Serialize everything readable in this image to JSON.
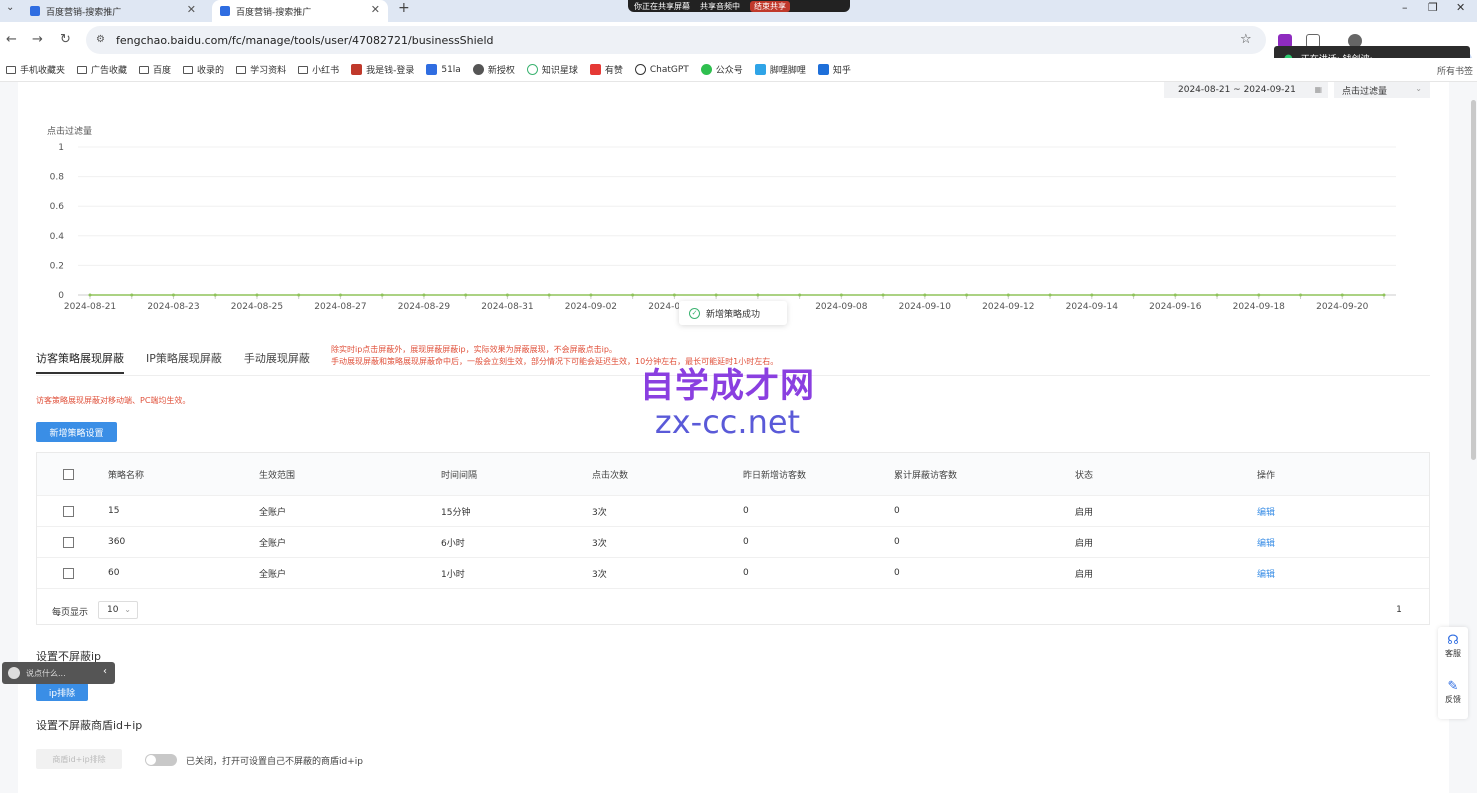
{
  "browser": {
    "tabs": [
      {
        "title": "百度营销-搜索推广"
      },
      {
        "title": "百度营销-搜索推广"
      }
    ],
    "share_bar": {
      "status": "你正在共享屏幕",
      "audio": "共享音频中",
      "end": "结束共享"
    },
    "url": "fengchao.baidu.com/fc/manage/tools/user/47082721/businessShield",
    "speaking_popup": "正在讲话: 钱剑波;",
    "bookmarks": [
      "手机收藏夹",
      "广告收藏",
      "百度",
      "收录的",
      "学习资料",
      "小红书",
      "我是钱-登录",
      "51la",
      "新授权",
      "知识星球",
      "有赞",
      "ChatGPT",
      "公众号",
      "脚哩脚哩",
      "知乎"
    ],
    "bookmarks_right": "所有书签"
  },
  "filters": {
    "date_range": "2024-08-21 ~ 2024-09-21",
    "metric": "点击过滤量"
  },
  "chart_data": {
    "type": "line",
    "ylabel": "点击过滤量",
    "ylim": [
      0,
      1
    ],
    "yticks": [
      "1",
      "0.8",
      "0.6",
      "0.4",
      "0.2",
      "0"
    ],
    "xticks": [
      "2024-08-21",
      "2024-08-23",
      "2024-08-25",
      "2024-08-27",
      "2024-08-29",
      "2024-08-31",
      "2024-09-02",
      "2024-09-04",
      "2024-09-06",
      "2024-09-08",
      "2024-09-10",
      "2024-09-12",
      "2024-09-14",
      "2024-09-16",
      "2024-09-18",
      "2024-09-20"
    ],
    "x": [
      "2024-08-21",
      "2024-08-22",
      "2024-08-23",
      "2024-08-24",
      "2024-08-25",
      "2024-08-26",
      "2024-08-27",
      "2024-08-28",
      "2024-08-29",
      "2024-08-30",
      "2024-08-31",
      "2024-09-01",
      "2024-09-02",
      "2024-09-03",
      "2024-09-04",
      "2024-09-05",
      "2024-09-06",
      "2024-09-07",
      "2024-09-08",
      "2024-09-09",
      "2024-09-10",
      "2024-09-11",
      "2024-09-12",
      "2024-09-13",
      "2024-09-14",
      "2024-09-15",
      "2024-09-16",
      "2024-09-17",
      "2024-09-18",
      "2024-09-19",
      "2024-09-20",
      "2024-09-21"
    ],
    "series": [
      {
        "values": [
          0,
          0,
          0,
          0,
          0,
          0,
          0,
          0,
          0,
          0,
          0,
          0,
          0,
          0,
          0,
          0,
          0,
          0,
          0,
          0,
          0,
          0,
          0,
          0,
          0,
          0,
          0,
          0,
          0,
          0,
          0,
          0
        ],
        "color": "#8fc35a"
      }
    ],
    "grid": true
  },
  "toast": "新增策略成功",
  "tabs": [
    "访客策略展现屏蔽",
    "IP策略展现屏蔽",
    "手动展现屏蔽"
  ],
  "tab_note": [
    "除实时ip点击屏蔽外，展现屏蔽屏蔽ip，实际效果为屏蔽展现，不会屏蔽点击ip。",
    "手动展现屏蔽和策略展现屏蔽命中后，一般会立刻生效，部分情况下可能会延迟生效，10分钟左右，最长可能延时1小时左右。"
  ],
  "mobile_note": "访客策略展现屏蔽对移动端、PC端均生效。",
  "add_button": "新增策略设置",
  "table": {
    "headers": [
      "策略名称",
      "生效范围",
      "时间间隔",
      "点击次数",
      "昨日新增访客数",
      "累计屏蔽访客数",
      "状态",
      "操作"
    ],
    "rows": [
      [
        "15",
        "全账户",
        "15分钟",
        "3次",
        "0",
        "0",
        "启用",
        "编辑"
      ],
      [
        "360",
        "全账户",
        "6小时",
        "3次",
        "0",
        "0",
        "启用",
        "编辑"
      ],
      [
        "60",
        "全账户",
        "1小时",
        "3次",
        "0",
        "0",
        "启用",
        "编辑"
      ]
    ]
  },
  "pager": {
    "label": "每页显示",
    "page_size": "10",
    "page": "1"
  },
  "section_ip": {
    "title": "设置不屏蔽ip",
    "button": "ip排除"
  },
  "section_biz": {
    "title": "设置不屏蔽商盾id+ip",
    "button": "商盾id+ip排除",
    "switch_note": "已关闭，打开可设置自己不屏蔽的商盾id+ip"
  },
  "mini_bar": {
    "placeholder": "说点什么..."
  },
  "side_float": {
    "service": "客服",
    "feedback": "反馈"
  },
  "watermark": {
    "cn": "自学成才网",
    "en": "zx-cc.net"
  }
}
